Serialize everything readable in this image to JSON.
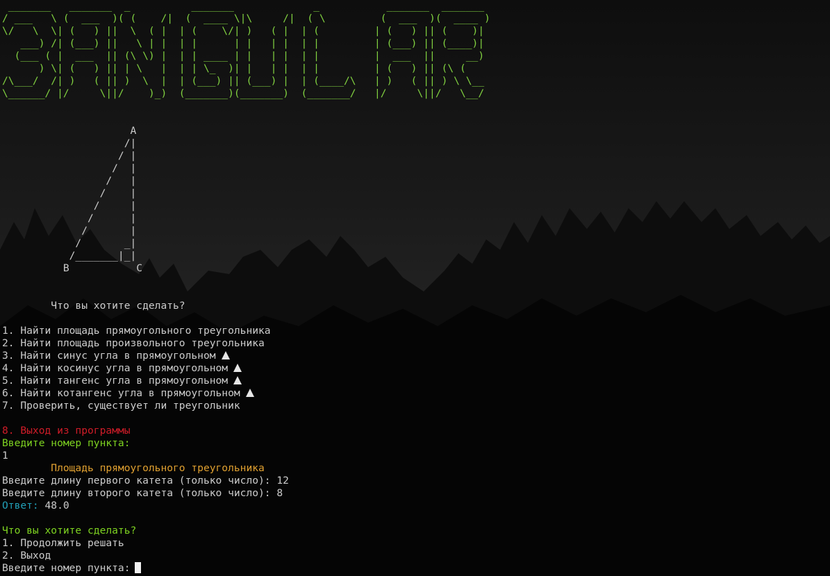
{
  "banner": [
    " _______   _______  _          _______             _           _______  _______ ",
    "/ ___   \\ (  ___  )( (    /|  (  ____ \\|\\     /|  ( \\         (  ___  )(  ____ )",
    "\\/   \\  \\| (   ) ||  \\  ( |  | (    \\/| )   ( |  | (         | (   ) || (    )|",
    "   ___) /| (___) ||   \\ | |  | |      | |   | |  | |         | (___) || (____)|",
    "  (___ ( |  ___  || (\\ \\) |  | | ____ | |   | |  | |         |  ___  ||     __)",
    "      ) \\| (   ) || | \\   |  | | \\_  )| |   | |  | |         | (   ) || (\\ (   ",
    "/\\___/  /| )   ( || )  \\  |  | (___) || (___) |  | (____/\\   | )   ( || ) \\ \\__",
    "\\______/ |/     \\||/    )_)  (_______)(_______)  (_______/   |/     \\||/   \\__/"
  ],
  "triangle_art": [
    "                     A",
    "                    /|",
    "                   / |",
    "                  /  |",
    "                 /   |",
    "                /    |",
    "               /     |",
    "              /      |",
    "             /       |",
    "            /       _|",
    "           /_______|_|",
    "          B           C"
  ],
  "menu": {
    "prompt": "        Что вы хотите сделать?",
    "items": [
      {
        "label": "1. Найти площадь прямоугольного треугольника",
        "icon": ""
      },
      {
        "label": "2. Найти площадь произвольного треугольника",
        "icon": ""
      },
      {
        "label": "3. Найти синус угла в прямоугольном",
        "icon": "triangle-icon"
      },
      {
        "label": "4. Найти косинус угла в прямоугольном",
        "icon": "triangle-icon"
      },
      {
        "label": "5. Найти тангенс угла в прямоугольном",
        "icon": "triangle-icon"
      },
      {
        "label": "6. Найти котангенс угла в прямоугольном",
        "icon": "triangle-icon"
      },
      {
        "label": "7. Проверить, существует ли треугольник",
        "icon": ""
      }
    ],
    "exit_label": "8. Выход из программы",
    "input_prompt": "Введите номер пункта:",
    "user_input": "1"
  },
  "result": {
    "section_title": "        Площадь прямоугольного треугольника",
    "leg1_prompt": "Введите длину первого катета (только число): 12",
    "leg2_prompt": "Введите длину второго катета (только число): 8",
    "answer_label": "Ответ:",
    "answer_value": " 48.0"
  },
  "continue_menu": {
    "prompt": "Что вы хотите сделать?",
    "items": [
      "1. Продолжить решать",
      "2. Выход"
    ],
    "input_prompt": "Введите номер пункта:"
  },
  "colors": {
    "green": "#7ed321",
    "red": "#d01c28",
    "orange": "#e0a030",
    "cyan": "#22a0b8",
    "text": "#cccccc",
    "background": "#0c0c0c"
  }
}
